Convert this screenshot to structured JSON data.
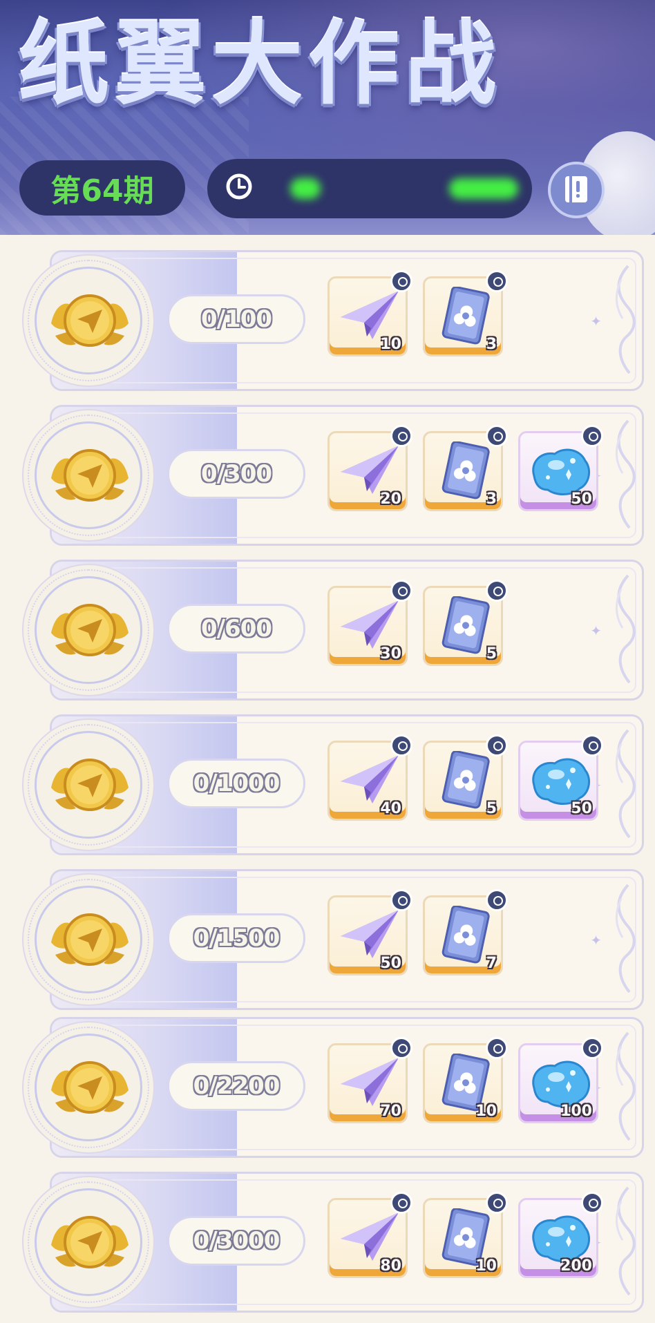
{
  "header": {
    "title": "纸翼大作战",
    "issue_label": "第64期",
    "timer_icon": "clock-icon",
    "guide_icon": "book-icon"
  },
  "rows": [
    {
      "progress": "0/100",
      "rewards": [
        {
          "type": "paper-plane",
          "qty": "10"
        },
        {
          "type": "card-pack",
          "qty": "3"
        }
      ]
    },
    {
      "progress": "0/300",
      "rewards": [
        {
          "type": "paper-plane",
          "qty": "20"
        },
        {
          "type": "card-pack",
          "qty": "3"
        },
        {
          "type": "slime-gem",
          "qty": "50"
        }
      ]
    },
    {
      "progress": "0/600",
      "rewards": [
        {
          "type": "paper-plane",
          "qty": "30"
        },
        {
          "type": "card-pack",
          "qty": "5"
        }
      ]
    },
    {
      "progress": "0/1000",
      "rewards": [
        {
          "type": "paper-plane",
          "qty": "40"
        },
        {
          "type": "card-pack",
          "qty": "5"
        },
        {
          "type": "slime-gem",
          "qty": "50"
        }
      ]
    },
    {
      "progress": "0/1500",
      "rewards": [
        {
          "type": "paper-plane",
          "qty": "50"
        },
        {
          "type": "card-pack",
          "qty": "7"
        }
      ]
    },
    {
      "progress": "0/2200",
      "rewards": [
        {
          "type": "paper-plane",
          "qty": "70"
        },
        {
          "type": "card-pack",
          "qty": "10"
        },
        {
          "type": "slime-gem",
          "qty": "100"
        }
      ]
    },
    {
      "progress": "0/3000",
      "rewards": [
        {
          "type": "paper-plane",
          "qty": "80"
        },
        {
          "type": "card-pack",
          "qty": "10"
        },
        {
          "type": "slime-gem",
          "qty": "200"
        }
      ]
    }
  ],
  "colors": {
    "header_bg": "#3a3f86",
    "issue_text": "#66dd55",
    "card_bg": "#faf6ee",
    "orange_rarity": "#f0a73a",
    "purple_rarity": "#c58fe6"
  }
}
